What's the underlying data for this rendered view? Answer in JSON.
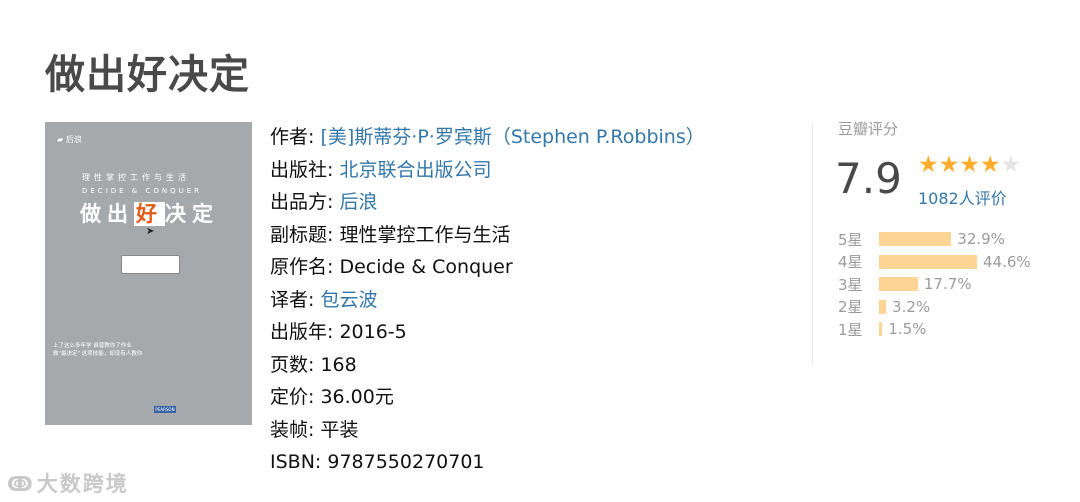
{
  "book": {
    "title": "做出好决定",
    "cover": {
      "subtitle": "理性掌控工作与生活",
      "english": "DECIDE & CONQUER",
      "title_pre": "做出",
      "title_accent": "好",
      "title_post": "决定",
      "blurb": "上了这么多年学 谁曾教你了作业 做\"最决定\" 这项技能，却没有人教你",
      "pearson": "PEARSON"
    },
    "info": [
      {
        "label": "作者: ",
        "value": "[美]斯蒂芬·P·罗宾斯（Stephen P.Robbins）",
        "link": true
      },
      {
        "label": "出版社: ",
        "value": "北京联合出版公司",
        "link": true
      },
      {
        "label": "出品方: ",
        "value": "后浪",
        "link": true
      },
      {
        "label": "副标题: ",
        "value": "理性掌控工作与生活",
        "link": false
      },
      {
        "label": "原作名: ",
        "value": "Decide & Conquer",
        "link": false
      },
      {
        "label": "译者: ",
        "value": "包云波",
        "link": true
      },
      {
        "label": "出版年: ",
        "value": "2016-5",
        "link": false
      },
      {
        "label": "页数: ",
        "value": "168",
        "link": false
      },
      {
        "label": "定价: ",
        "value": "36.00元",
        "link": false
      },
      {
        "label": "装帧: ",
        "value": "平装",
        "link": false
      },
      {
        "label": "ISBN: ",
        "value": "9787550270701",
        "link": false
      }
    ]
  },
  "rating": {
    "label": "豆瓣评分",
    "score": "7.9",
    "stars_filled": 4,
    "stars_total": 5,
    "votes": "1082人评价",
    "distribution": [
      {
        "label": "5星",
        "percent": 32.9,
        "text": "32.9%"
      },
      {
        "label": "4星",
        "percent": 44.6,
        "text": "44.6%"
      },
      {
        "label": "3星",
        "percent": 17.7,
        "text": "17.7%"
      },
      {
        "label": "2星",
        "percent": 3.2,
        "text": "3.2%"
      },
      {
        "label": "1星",
        "percent": 1.5,
        "text": "1.5%"
      }
    ]
  },
  "watermark": {
    "text": "大数跨境",
    "icon": "logo-icon"
  },
  "colors": {
    "link": "#3377aa",
    "star": "#ffac2d",
    "bar": "#ffd596"
  }
}
